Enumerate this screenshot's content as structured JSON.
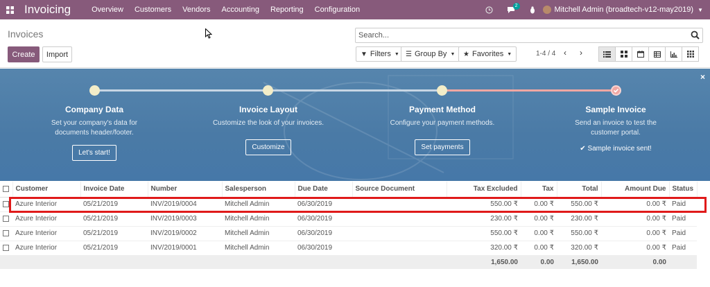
{
  "navbar": {
    "brand": "Invoicing",
    "menu": [
      "Overview",
      "Customers",
      "Vendors",
      "Accounting",
      "Reporting",
      "Configuration"
    ],
    "chat_count": "2",
    "user": "Mitchell Admin (broadtech-v12-may2019)",
    "color": "#875a7b"
  },
  "control": {
    "title": "Invoices",
    "create_label": "Create",
    "import_label": "Import",
    "search_placeholder": "Search...",
    "filters_label": "Filters",
    "groupby_label": "Group By",
    "favorites_label": "Favorites",
    "pager": "1-4 / 4"
  },
  "banner": {
    "steps": [
      {
        "title": "Company Data",
        "desc": "Set your company's data for documents header/footer.",
        "button": "Let's start!"
      },
      {
        "title": "Invoice Layout",
        "desc": "Customize the look of your invoices.",
        "button": "Customize"
      },
      {
        "title": "Payment Method",
        "desc": "Configure your payment methods.",
        "button": "Set payments"
      },
      {
        "title": "Sample Invoice",
        "desc": "Send an invoice to test the customer portal.",
        "done_text": "Sample invoice sent!"
      }
    ]
  },
  "table": {
    "headers": {
      "customer": "Customer",
      "invoice_date": "Invoice Date",
      "number": "Number",
      "salesperson": "Salesperson",
      "due_date": "Due Date",
      "source": "Source Document",
      "tax_excluded": "Tax Excluded",
      "tax": "Tax",
      "total": "Total",
      "amount_due": "Amount Due",
      "status": "Status"
    },
    "rows": [
      {
        "customer": "Azure Interior",
        "invoice_date": "05/21/2019",
        "number": "INV/2019/0004",
        "salesperson": "Mitchell Admin",
        "due_date": "06/30/2019",
        "source": "",
        "tax_excluded": "550.00 ₹",
        "tax": "0.00 ₹",
        "total": "550.00 ₹",
        "amount_due": "0.00 ₹",
        "status": "Paid"
      },
      {
        "customer": "Azure Interior",
        "invoice_date": "05/21/2019",
        "number": "INV/2019/0003",
        "salesperson": "Mitchell Admin",
        "due_date": "06/30/2019",
        "source": "",
        "tax_excluded": "230.00 ₹",
        "tax": "0.00 ₹",
        "total": "230.00 ₹",
        "amount_due": "0.00 ₹",
        "status": "Paid"
      },
      {
        "customer": "Azure Interior",
        "invoice_date": "05/21/2019",
        "number": "INV/2019/0002",
        "salesperson": "Mitchell Admin",
        "due_date": "06/30/2019",
        "source": "",
        "tax_excluded": "550.00 ₹",
        "tax": "0.00 ₹",
        "total": "550.00 ₹",
        "amount_due": "0.00 ₹",
        "status": "Paid"
      },
      {
        "customer": "Azure Interior",
        "invoice_date": "05/21/2019",
        "number": "INV/2019/0001",
        "salesperson": "Mitchell Admin",
        "due_date": "06/30/2019",
        "source": "",
        "tax_excluded": "320.00 ₹",
        "tax": "0.00 ₹",
        "total": "320.00 ₹",
        "amount_due": "0.00 ₹",
        "status": "Paid"
      }
    ],
    "footer": {
      "tax_excluded": "1,650.00",
      "tax": "0.00",
      "total": "1,650.00",
      "amount_due": "0.00"
    }
  }
}
